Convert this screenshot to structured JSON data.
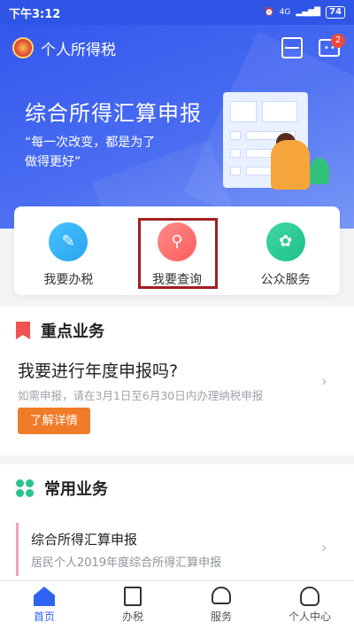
{
  "statusbar": {
    "time": "下午3:12",
    "network": "4G",
    "battery": "74"
  },
  "appbar": {
    "title": "个人所得税",
    "badge_count": "2",
    "icons": [
      "scan-icon",
      "message-icon"
    ]
  },
  "hero": {
    "title": "综合所得汇算申报",
    "subtitle": "“每一次改变，都是为了做得更好”"
  },
  "actions": [
    {
      "label": "我要办税",
      "icon": "pencil-icon",
      "color": "#2aa4ee"
    },
    {
      "label": "我要查询",
      "icon": "search-icon",
      "color": "#ff5d5d"
    },
    {
      "label": "公众服务",
      "icon": "flower-icon",
      "color": "#1fc08c"
    }
  ],
  "key_section": {
    "title": "重点业务",
    "item_title": "我要进行年度申报吗?",
    "item_subtitle": "如需申报，请在3月1日至6月30日内办理纳税申报",
    "button_label": "了解详情"
  },
  "common_section": {
    "title": "常用业务",
    "item_title": "综合所得汇算申报",
    "item_subtitle": "居民个人2019年度综合所得汇算申报"
  },
  "bottom_nav": [
    {
      "label": "首页",
      "icon": "home-icon",
      "active": true
    },
    {
      "label": "办税",
      "icon": "document-icon",
      "active": false
    },
    {
      "label": "服务",
      "icon": "heart-hand-icon",
      "active": false
    },
    {
      "label": "个人中心",
      "icon": "user-icon",
      "active": false
    }
  ],
  "colors": {
    "brand_blue": "#3357ec",
    "accent_orange": "#f07b29",
    "highlight_box": "#a51d20"
  }
}
